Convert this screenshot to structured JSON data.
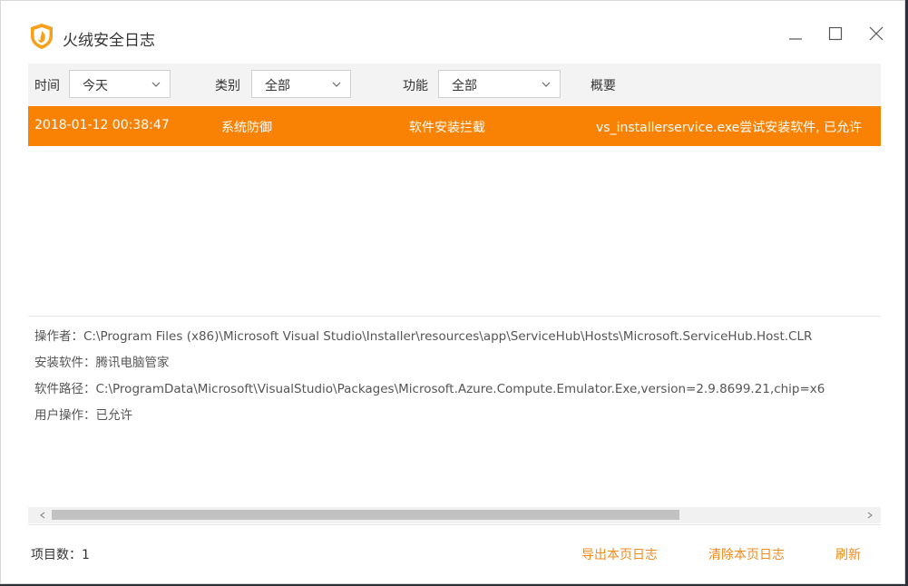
{
  "window": {
    "title": "火绒安全日志",
    "accent_color": "#f98205",
    "logo_icon": "huorong-shield-flame-icon"
  },
  "filters": {
    "time_label": "时间",
    "time_value": "今天",
    "category_label": "类别",
    "category_value": "全部",
    "function_label": "功能",
    "function_value": "全部",
    "summary_header": "概要"
  },
  "log_rows": [
    {
      "time": "2018-01-12 00:38:47",
      "category": "系统防御",
      "function": "软件安装拦截",
      "summary": "vs_installerservice.exe尝试安装软件, 已允许",
      "selected": true
    }
  ],
  "details": {
    "operator": "操作者：C:\\Program Files (x86)\\Microsoft Visual Studio\\Installer\\resources\\app\\ServiceHub\\Hosts\\Microsoft.ServiceHub.Host.CLR",
    "installed_software": "安装软件：腾讯电脑管家",
    "software_path": "软件路径：C:\\ProgramData\\Microsoft\\VisualStudio\\Packages\\Microsoft.Azure.Compute.Emulator.Exe,version=2.9.8699.21,chip=x6",
    "user_action": "用户操作：已允许"
  },
  "footer": {
    "item_count": "项目数：1",
    "export_label": "导出本页日志",
    "clear_label": "清除本页日志",
    "refresh_label": "刷新"
  }
}
